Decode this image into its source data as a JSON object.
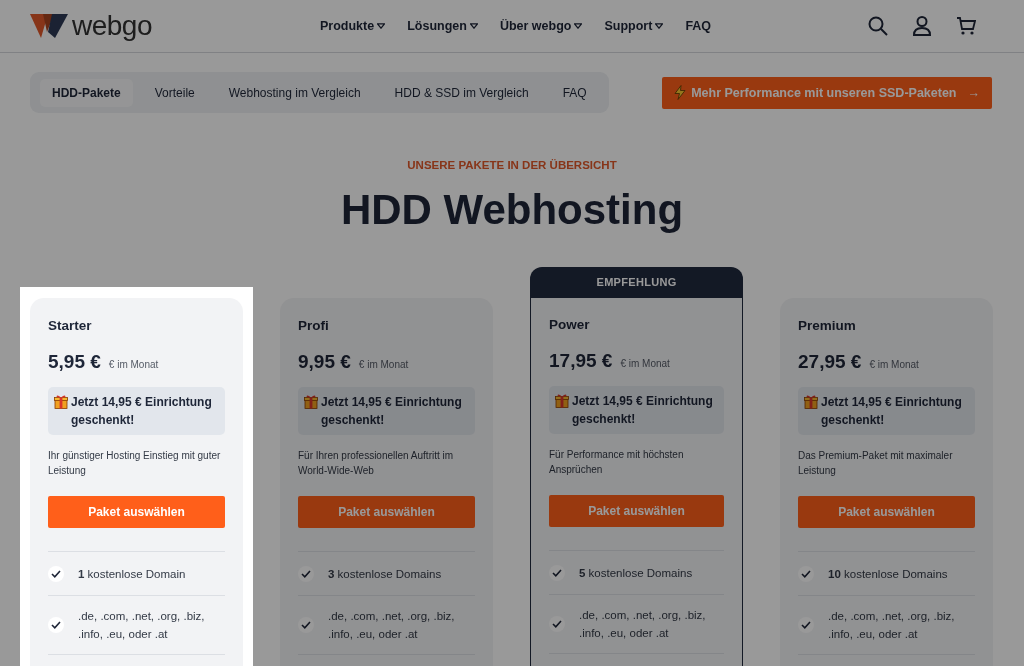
{
  "header": {
    "logo_text": "webgo",
    "nav": [
      {
        "label": "Produkte",
        "dropdown": true
      },
      {
        "label": "Lösungen",
        "dropdown": true
      },
      {
        "label": "Über webgo",
        "dropdown": true
      },
      {
        "label": "Support",
        "dropdown": true
      },
      {
        "label": "FAQ",
        "dropdown": false
      }
    ]
  },
  "subnav": {
    "tabs": [
      {
        "label": "HDD-Pakete",
        "selected": true
      },
      {
        "label": "Vorteile",
        "selected": false
      },
      {
        "label": "Webhosting im Vergleich",
        "selected": false
      },
      {
        "label": "HDD & SSD im Vergleich",
        "selected": false
      },
      {
        "label": "FAQ",
        "selected": false
      }
    ],
    "cta": {
      "label": "Mehr Performance mit unseren SSD-Paketen",
      "arrow": "→"
    }
  },
  "section": {
    "eyebrow": "UNSERE PAKETE IN DER ÜBERSICHT",
    "title": "HDD Webhosting"
  },
  "plans": [
    {
      "name": "Starter",
      "price": "5,95 €",
      "unit": "€ im Monat",
      "promo": "Jetzt 14,95 € Einrichtung geschenkt!",
      "description": "Ihr günstiger Hosting Einstieg mit guter Leistung",
      "button": "Paket auswählen",
      "spotlight": true,
      "features": [
        "**1** kostenlose Domain",
        ".de, .com, .net, .org, .biz, .info, .eu, oder .at"
      ]
    },
    {
      "name": "Profi",
      "price": "9,95 €",
      "unit": "€ im Monat",
      "promo": "Jetzt 14,95 € Einrichtung geschenkt!",
      "description": "Für Ihren professionellen Auftritt im World-Wide-Web",
      "button": "Paket auswählen",
      "spotlight": false,
      "features": [
        "**3** kostenlose Domains",
        ".de, .com, .net, .org, .biz, .info, .eu, oder .at"
      ]
    },
    {
      "name": "Power",
      "badge": "EMPFEHLUNG",
      "price": "17,95 €",
      "unit": "€ im Monat",
      "promo": "Jetzt 14,95 € Einrichtung geschenkt!",
      "description": "Für Performance mit höchsten Ansprüchen",
      "button": "Paket auswählen",
      "spotlight": false,
      "features": [
        "**5** kostenlose Domains",
        ".de, .com, .net, .org, .biz, .info, .eu, oder .at"
      ]
    },
    {
      "name": "Premium",
      "price": "27,95 €",
      "unit": "€ im Monat",
      "promo": "Jetzt 14,95 € Einrichtung geschenkt!",
      "description": "Das Premium-Paket mit maximaler Leistung",
      "button": "Paket auswählen",
      "spotlight": false,
      "features": [
        "**10** kostenlose Domains",
        ".de, .com, .net, .org, .biz, .info, .eu, oder .at"
      ]
    }
  ]
}
